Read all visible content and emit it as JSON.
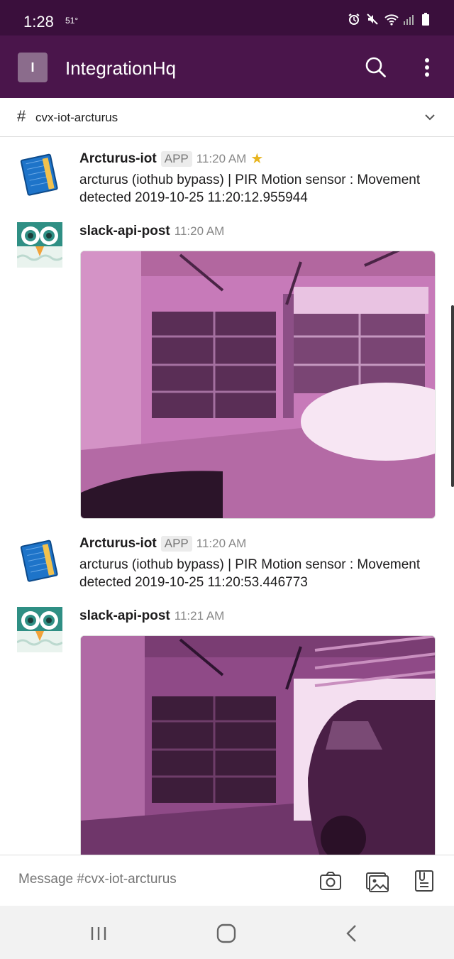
{
  "status_bar": {
    "time": "1:28",
    "temperature": "51°"
  },
  "app_bar": {
    "workspace_initial": "I",
    "workspace_name": "IntegrationHq"
  },
  "channel": {
    "hash": "#",
    "name": "cvx-iot-arcturus"
  },
  "messages": [
    {
      "sender": "Arcturus-iot",
      "badge": "APP",
      "time": "11:20 AM",
      "starred": true,
      "text": "arcturus (iothub bypass) | PIR Motion sensor : Movement detected 2019-10-25 11:20:12.955944"
    },
    {
      "sender": "slack-api-post",
      "time": "11:20 AM",
      "image": "garage-photo-door-open"
    },
    {
      "sender": "Arcturus-iot",
      "badge": "APP",
      "time": "11:20 AM",
      "text": "arcturus (iothub bypass) | PIR Motion sensor : Movement detected 2019-10-25 11:20:53.446773"
    },
    {
      "sender": "slack-api-post",
      "time": "11:21 AM",
      "image": "garage-photo-car"
    }
  ],
  "composer": {
    "placeholder": "Message #cvx-iot-arcturus"
  },
  "colors": {
    "status_bar": "#3a0f3c",
    "app_bar": "#4a154b",
    "star": "#e8b520"
  }
}
